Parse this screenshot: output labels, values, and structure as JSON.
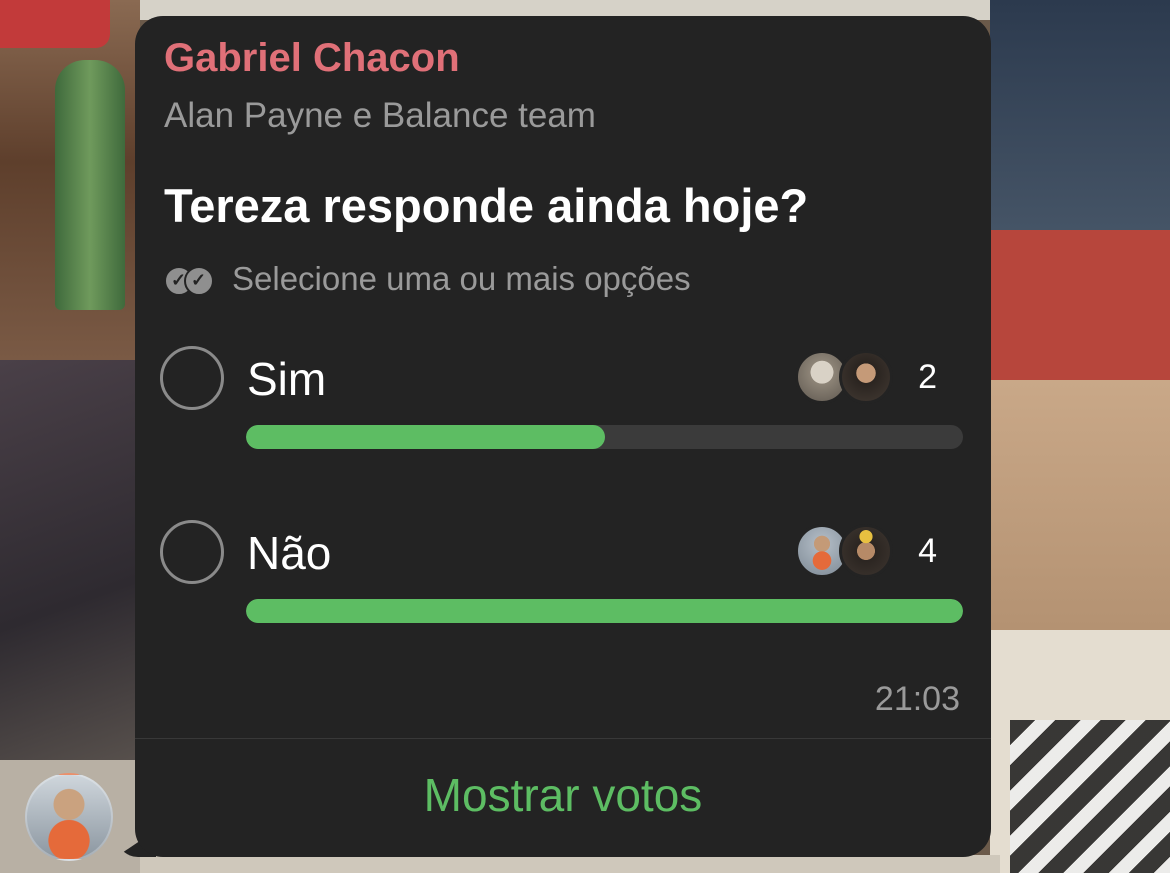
{
  "message": {
    "sender_name": "Gabriel Chacon",
    "participants": "Alan Payne e Balance team",
    "time": "21:03"
  },
  "poll": {
    "question": "Tereza responde ainda hoje?",
    "hint": "Selecione uma ou mais opções",
    "hint_icon": "double-check-icon",
    "options": [
      {
        "label": "Sim",
        "votes": "2",
        "fill_fraction": 0.5,
        "selected": false
      },
      {
        "label": "Não",
        "votes": "4",
        "fill_fraction": 1.0,
        "selected": false
      }
    ],
    "show_votes_label": "Mostrar votos"
  },
  "colors": {
    "bubble": "#232323",
    "sender_name": "#e07078",
    "accent_green": "#5dbd63",
    "muted_text": "#9a9a9a"
  }
}
